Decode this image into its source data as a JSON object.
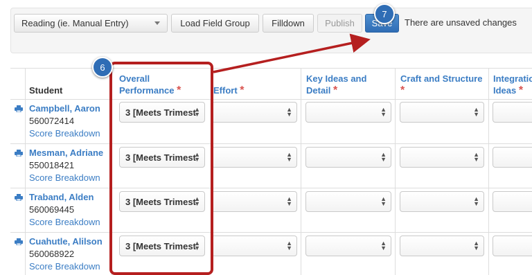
{
  "toolbar": {
    "entry_select": "Reading (ie. Manual Entry)",
    "load_label": "Load Field Group",
    "filldown_label": "Filldown",
    "publish_label": "Publish",
    "save_label": "Save",
    "unsaved_text": "There are unsaved changes"
  },
  "badges": {
    "step7": "7",
    "step6": "6"
  },
  "table": {
    "headers": {
      "student": "Student",
      "overall_line1": "Overall",
      "overall_line2": "Performance",
      "effort": "Effort",
      "key_line1": "Key Ideas and",
      "key_line2": "Detail",
      "craft_line1": "Craft and Structure",
      "integ_line1": "Integratio",
      "integ_line2": "Ideas",
      "required_mark": "*"
    },
    "rows": [
      {
        "name": "Campbell, Aaron",
        "id": "560072414",
        "breakdown": "Score Breakdown",
        "overall": "3 [Meets Trimest"
      },
      {
        "name": "Mesman, Adriane",
        "id": "550018421",
        "breakdown": "Score Breakdown",
        "overall": "3 [Meets Trimest"
      },
      {
        "name": "Traband, Alden",
        "id": "560069445",
        "breakdown": "Score Breakdown",
        "overall": "3 [Meets Trimest"
      },
      {
        "name": "Cuahutle, Alilson",
        "id": "560068922",
        "breakdown": "Score Breakdown",
        "overall": "3 [Meets Trimest"
      }
    ]
  },
  "colors": {
    "link": "#3b7dc4",
    "required": "#d9534f",
    "annotation": "#b51f1f",
    "save_button": "#2f6db5"
  }
}
